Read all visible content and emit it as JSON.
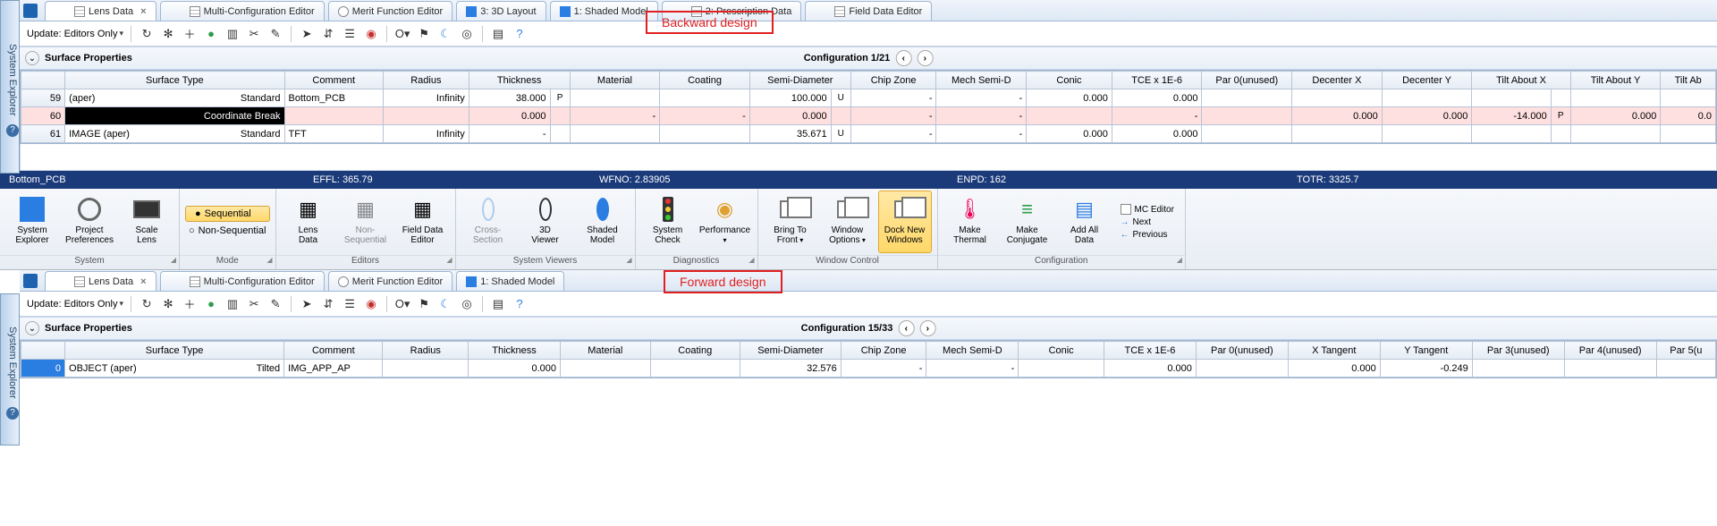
{
  "labels": {
    "system_explorer": "System Explorer",
    "update": "Update: Editors Only",
    "surface_properties": "Surface Properties",
    "annot_back": "Backward design",
    "annot_fwd": "Forward design"
  },
  "tabs_top": [
    {
      "label": "Lens Data",
      "active": true,
      "closable": true,
      "icon": "grid"
    },
    {
      "label": "Multi-Configuration Editor",
      "icon": "grid"
    },
    {
      "label": "Merit Function Editor",
      "icon": "circle"
    },
    {
      "label": "3: 3D Layout",
      "icon": "blue"
    },
    {
      "label": "1: Shaded Model",
      "icon": "blue"
    },
    {
      "label": "2: Prescription Data",
      "icon": "grid"
    },
    {
      "label": "Field Data Editor",
      "icon": "grid"
    }
  ],
  "tabs_bot": [
    {
      "label": "Lens Data",
      "active": true,
      "closable": true,
      "icon": "grid"
    },
    {
      "label": "Multi-Configuration Editor",
      "icon": "grid"
    },
    {
      "label": "Merit Function Editor",
      "icon": "circle"
    },
    {
      "label": "1: Shaded Model",
      "icon": "blue"
    }
  ],
  "config_top": "Configuration 1/21",
  "config_bot": "Configuration 15/33",
  "columns_top": [
    "",
    "Surface Type",
    "Comment",
    "Radius",
    "Thickness",
    "",
    "Material",
    "Coating",
    "Semi-Diameter",
    "",
    "Chip Zone",
    "Mech Semi-D",
    "Conic",
    "TCE x 1E-6",
    "Par 0(unused)",
    "Decenter X",
    "Decenter Y",
    "Tilt About X",
    "",
    "Tilt About Y",
    "Tilt Ab"
  ],
  "rows_top": [
    {
      "n": "59",
      "surf": "(aper)",
      "type": "Standard",
      "comment": "Bottom_PCB",
      "radius": "Infinity",
      "thk": "38.000",
      "thk_sfx": "P",
      "mat": "",
      "coat": "",
      "sd": "100.000",
      "sd_sfx": "U",
      "chip": "-",
      "mech": "-",
      "conic": "0.000",
      "tce": "0.000",
      "p0": "",
      "dx": "",
      "dy": "",
      "tax": "",
      "tax_sfx": "",
      "tay": "",
      "tab": ""
    },
    {
      "n": "60",
      "surf": "",
      "type": "Coordinate Break",
      "comment": "",
      "radius": "",
      "thk": "0.000",
      "thk_sfx": "",
      "mat": "-",
      "coat": "-",
      "sd": "0.000",
      "sd_sfx": "",
      "chip": "-",
      "mech": "-",
      "conic": "",
      "tce": "-",
      "p0": "",
      "dx": "0.000",
      "dy": "0.000",
      "tax": "-14.000",
      "tax_sfx": "P",
      "tay": "0.000",
      "tab": "0.0",
      "pink": true
    },
    {
      "n": "61",
      "surf": "IMAGE (aper)",
      "type": "Standard",
      "comment": "TFT",
      "radius": "Infinity",
      "thk": "-",
      "thk_sfx": "",
      "mat": "",
      "coat": "",
      "sd": "35.671",
      "sd_sfx": "U",
      "chip": "-",
      "mech": "-",
      "conic": "0.000",
      "tce": "0.000",
      "p0": "",
      "dx": "",
      "dy": "",
      "tax": "",
      "tax_sfx": "",
      "tay": "",
      "tab": ""
    }
  ],
  "columns_bot": [
    "",
    "Surface Type",
    "Comment",
    "Radius",
    "Thickness",
    "Material",
    "Coating",
    "Semi-Diameter",
    "Chip Zone",
    "Mech Semi-D",
    "Conic",
    "TCE x 1E-6",
    "Par 0(unused)",
    "X Tangent",
    "Y Tangent",
    "Par 3(unused)",
    "Par 4(unused)",
    "Par 5(u"
  ],
  "rows_bot": [
    {
      "n": "0",
      "surf": "OBJECT (aper)",
      "type": "Tilted",
      "comment": "IMG_APP_AP",
      "radius": "",
      "thk": "0.000",
      "mat": "",
      "coat": "",
      "sd": "32.576",
      "chip": "-",
      "mech": "-",
      "conic": "",
      "tce": "0.000",
      "p0": "",
      "xt": "0.000",
      "yt": "-0.249",
      "p3": "",
      "p4": "",
      "p5": "",
      "sel": true
    }
  ],
  "status": {
    "left": "Bottom_PCB",
    "effl": "EFFL: 365.79",
    "wfno": "WFNO: 2.83905",
    "enpd": "ENPD: 162",
    "totr": "TOTR: 3325.7"
  },
  "ribbon": {
    "groups": {
      "system": "System",
      "mode": "Mode",
      "editors": "Editors",
      "viewers": "System Viewers",
      "diag": "Diagnostics",
      "winctl": "Window Control",
      "config": "Configuration"
    },
    "btns": {
      "sysexp": "System\nExplorer",
      "prefs": "Project\nPreferences",
      "scale": "Scale\nLens",
      "seq": "Sequential",
      "nseq": "Non-Sequential",
      "lensdata": "Lens\nData",
      "nonseq": "Non-Sequential",
      "fielded": "Field Data\nEditor",
      "cross": "Cross-Section",
      "v3d": "3D\nViewer",
      "shaded": "Shaded\nModel",
      "syscheck": "System\nCheck",
      "perf": "Performance",
      "bring": "Bring To\nFront",
      "winopt": "Window\nOptions",
      "dock": "Dock New\nWindows",
      "thermal": "Make\nThermal",
      "conj": "Make\nConjugate",
      "addall": "Add All\nData",
      "mced": "MC Editor",
      "next": "Next",
      "prev": "Previous"
    }
  }
}
